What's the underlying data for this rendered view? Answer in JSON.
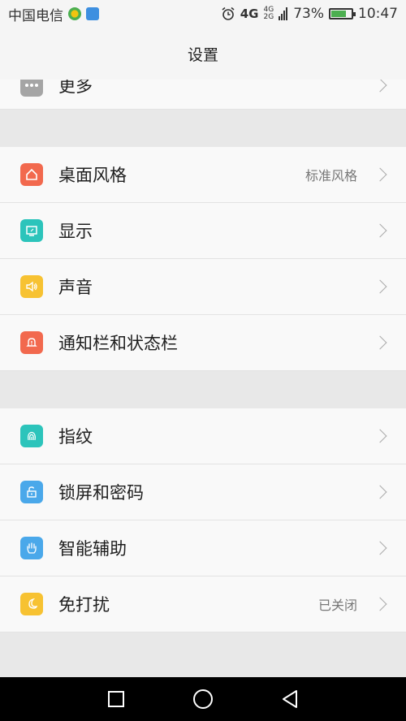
{
  "status_bar": {
    "carrier": "中国电信",
    "network": "4G",
    "network_small_top": "4G",
    "network_small_bottom": "2G",
    "battery_percent": "73%",
    "battery_level": 0.73,
    "time": "10:47"
  },
  "header": {
    "title": "设置"
  },
  "sections": [
    {
      "rows": [
        {
          "label": "更多",
          "value": "",
          "icon": "more-icon",
          "color": "#a5a5a5"
        }
      ]
    },
    {
      "rows": [
        {
          "label": "桌面风格",
          "value": "标准风格",
          "icon": "home-icon",
          "color": "#f2694e"
        },
        {
          "label": "显示",
          "value": "",
          "icon": "display-icon",
          "color": "#2cc4bb"
        },
        {
          "label": "声音",
          "value": "",
          "icon": "sound-icon",
          "color": "#f7c232"
        },
        {
          "label": "通知栏和状态栏",
          "value": "",
          "icon": "notification-icon",
          "color": "#f2694e"
        }
      ]
    },
    {
      "rows": [
        {
          "label": "指纹",
          "value": "",
          "icon": "fingerprint-icon",
          "color": "#2cc4bb"
        },
        {
          "label": "锁屏和密码",
          "value": "",
          "icon": "lock-icon",
          "color": "#4aa8ea"
        },
        {
          "label": "智能辅助",
          "value": "",
          "icon": "hand-icon",
          "color": "#4aa8ea"
        },
        {
          "label": "免打扰",
          "value": "已关闭",
          "icon": "moon-icon",
          "color": "#f7c232"
        }
      ]
    }
  ],
  "nav_bar": {
    "recent": "recent-apps-icon",
    "home": "home-circle-icon",
    "back": "back-triangle-icon"
  }
}
